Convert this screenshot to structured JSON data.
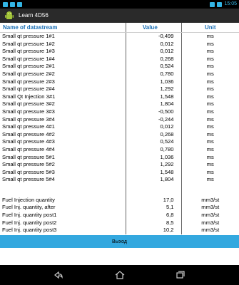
{
  "app": {
    "title": "Learn 4D56"
  },
  "status_bar": {
    "time": "15:05"
  },
  "table": {
    "headers": {
      "name": "Name of datastream",
      "value": "Value",
      "unit": "Unit"
    },
    "rows": [
      {
        "name": "Small qt pressure 1#1",
        "value": "-0,499",
        "unit": "ms"
      },
      {
        "name": "Small qt pressure 1#2",
        "value": "0,012",
        "unit": "ms"
      },
      {
        "name": "Small qt pressure 1#3",
        "value": "0,012",
        "unit": "ms"
      },
      {
        "name": "Small qt pressure 1#4",
        "value": "0,268",
        "unit": "ms"
      },
      {
        "name": "Small qt pressure 2#1",
        "value": "0,524",
        "unit": "ms"
      },
      {
        "name": "Small qt pressure 2#2",
        "value": "0,780",
        "unit": "ms"
      },
      {
        "name": "Small qt pressure 2#3",
        "value": "1,036",
        "unit": "ms"
      },
      {
        "name": "Small qt pressure 2#4",
        "value": "1,292",
        "unit": "ms"
      },
      {
        "name": "Small Qt Injection 3#1",
        "value": "1,548",
        "unit": "ms"
      },
      {
        "name": "Small qt pressure 3#2",
        "value": "1,804",
        "unit": "ms"
      },
      {
        "name": "Small qt pressure 3#3",
        "value": "-0,500",
        "unit": "ms"
      },
      {
        "name": "Small qt pressure 3#4",
        "value": "-0,244",
        "unit": "ms"
      },
      {
        "name": "Small qt pressure 4#1",
        "value": "0,012",
        "unit": "ms"
      },
      {
        "name": "Small qt pressure 4#2",
        "value": "0,268",
        "unit": "ms"
      },
      {
        "name": "Small qt pressure 4#3",
        "value": "0,524",
        "unit": "ms"
      },
      {
        "name": "Small qt pressure 4#4",
        "value": "0,780",
        "unit": "ms"
      },
      {
        "name": "Small qt pressure 5#1",
        "value": "1,036",
        "unit": "ms"
      },
      {
        "name": "Small qt pressure 5#2",
        "value": "1,292",
        "unit": "ms"
      },
      {
        "name": "Small qt pressure 5#3",
        "value": "1,548",
        "unit": "ms"
      },
      {
        "name": "Small qt pressure 5#4",
        "value": "1,804",
        "unit": "ms"
      }
    ],
    "fuel_rows": [
      {
        "name": "Fuel Injection quantity",
        "value": "17,0",
        "unit": "mm3/st"
      },
      {
        "name": "Fuel Inj. quantity, after",
        "value": "5,1",
        "unit": "mm3/st"
      },
      {
        "name": "Fuel Inj. quantity post1",
        "value": "6,8",
        "unit": "mm3/st"
      },
      {
        "name": "Fuel Inj. quantity post2",
        "value": "8,5",
        "unit": "mm3/st"
      },
      {
        "name": "Fuel Inj. quantity post3",
        "value": "10,2",
        "unit": "mm3/st"
      }
    ]
  },
  "exit_button": {
    "label": "Выход"
  },
  "icons": {
    "app": "android-app-icon",
    "back": "back-icon",
    "home": "home-icon",
    "recents": "recent-apps-icon"
  },
  "colors": {
    "header_text": "#1a6fb5",
    "exit_button": "#33a8df",
    "action_bar": "#2a2a2a"
  }
}
